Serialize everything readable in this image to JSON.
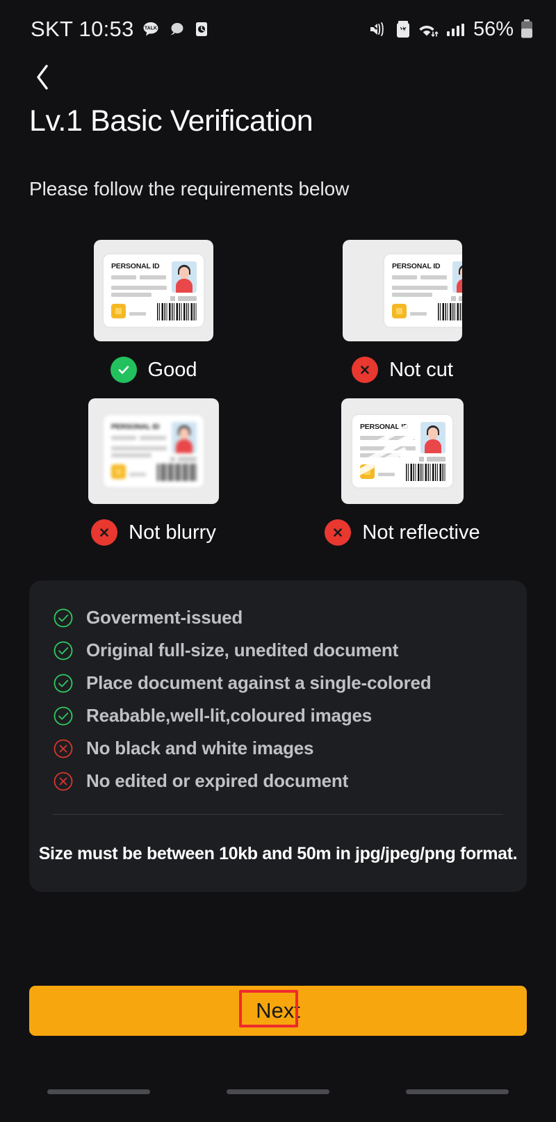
{
  "status_bar": {
    "carrier_time": "SKT 10:53",
    "notification_icons": [
      "kakaotalk-icon",
      "message-bubble-icon",
      "clock-app-icon"
    ],
    "right_icons": [
      "vibrate-icon",
      "battery-saver-icon",
      "wifi-icon",
      "cellular-signal-icon"
    ],
    "battery_percent": "56%"
  },
  "header": {
    "back_icon": "chevron-left-icon",
    "title": "Lv.1 Basic Verification",
    "subtitle": "Please follow the requirements below"
  },
  "samples": [
    {
      "label": "Good",
      "status": "ok",
      "icon": "check-circle-icon",
      "variant": "good"
    },
    {
      "label": "Not cut",
      "status": "bad",
      "icon": "x-circle-icon",
      "variant": "cut"
    },
    {
      "label": "Not blurry",
      "status": "bad",
      "icon": "x-circle-icon",
      "variant": "blurry"
    },
    {
      "label": "Not reflective",
      "status": "bad",
      "icon": "x-circle-icon",
      "variant": "reflect"
    }
  ],
  "id_card_sample": {
    "title": "PERSONAL ID",
    "photo": "person-portrait",
    "chip": "gold-chip",
    "barcode": "barcode"
  },
  "requirements": {
    "items": [
      {
        "text": "Goverment-issued",
        "status": "ok"
      },
      {
        "text": "Original full-size, unedited document",
        "status": "ok"
      },
      {
        "text": "Place document against a single-colored",
        "status": "ok"
      },
      {
        "text": "Reabable,well-lit,coloured images",
        "status": "ok"
      },
      {
        "text": "No black and white images",
        "status": "bad"
      },
      {
        "text": "No edited or expired document",
        "status": "bad"
      }
    ],
    "note": "Size must be between 10kb and 50m in jpg/jpeg/png format."
  },
  "footer": {
    "next_label": "Next"
  },
  "colors": {
    "background": "#111114",
    "card": "#1d1e21",
    "accent": "#f7a70d",
    "success": "#22c15e",
    "error": "#e8382f",
    "annotation": "#ef2b2b"
  }
}
